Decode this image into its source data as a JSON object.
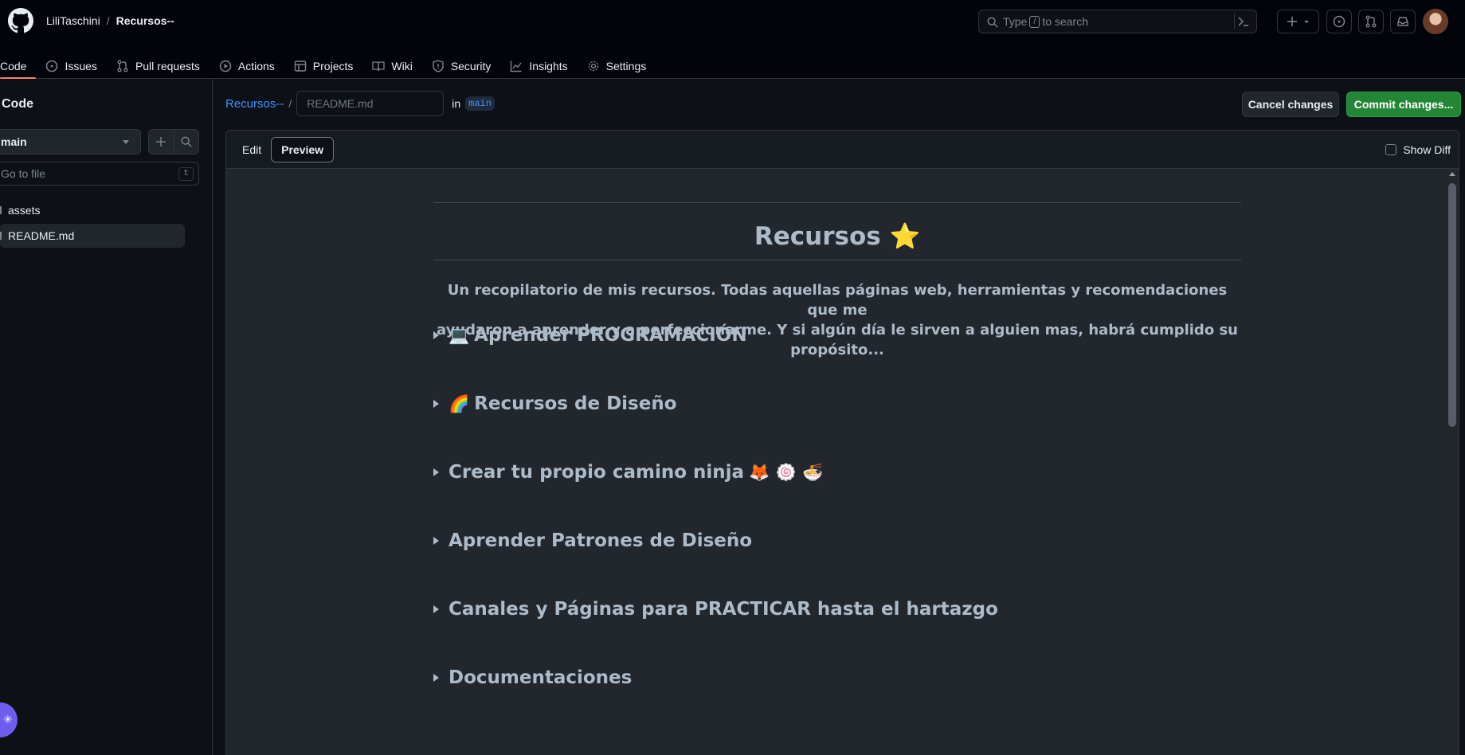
{
  "header": {
    "owner": "LiliTaschini",
    "separator": "/",
    "repo": "Recursos--",
    "search_prefix": "Type",
    "search_key": "/",
    "search_suffix": "to search"
  },
  "tabs": [
    {
      "label": "Code",
      "icon": "code-icon",
      "active": true
    },
    {
      "label": "Issues",
      "icon": "issue-icon"
    },
    {
      "label": "Pull requests",
      "icon": "pull-request-icon"
    },
    {
      "label": "Actions",
      "icon": "play-icon"
    },
    {
      "label": "Projects",
      "icon": "table-icon"
    },
    {
      "label": "Wiki",
      "icon": "book-icon"
    },
    {
      "label": "Security",
      "icon": "shield-icon"
    },
    {
      "label": "Insights",
      "icon": "graph-icon"
    },
    {
      "label": "Settings",
      "icon": "gear-icon"
    }
  ],
  "sidebar": {
    "title": "Code",
    "branch": "main",
    "goto_placeholder": "Go to file",
    "goto_shortcut": "t",
    "items": [
      {
        "label": "assets",
        "type": "folder"
      },
      {
        "label": "README.md",
        "type": "file",
        "selected": true
      }
    ]
  },
  "editor": {
    "repo_link": "Recursos--",
    "slash": "/",
    "filename_placeholder": "README.md",
    "in_label": "in",
    "branch": "main",
    "cancel_label": "Cancel changes",
    "commit_label": "Commit changes...",
    "edit_tab": "Edit",
    "preview_tab": "Preview",
    "show_diff_label": "Show Diff"
  },
  "preview": {
    "title": "Recursos",
    "title_emoji": "⭐",
    "intro_line1": "Un recopilatorio de mis recursos. Todas aquellas páginas web, herramientas y recomendaciones que me",
    "intro_line2": "ayudaron a aprender y a perfeccionarme. Y si algún día le sirven a alguien mas, habrá cumplido su propósito...",
    "sections": [
      {
        "emoji": "💻",
        "label": "Aprender PROGRAMACIÓN",
        "trailing": ""
      },
      {
        "emoji": "🌈",
        "label": "Recursos de Diseño",
        "trailing": ""
      },
      {
        "emoji": "",
        "label": "Crear tu propio camino ninja",
        "trailing": "🦊 🍥 🍜"
      },
      {
        "emoji": "",
        "label": "Aprender Patrones de Diseño",
        "trailing": ""
      },
      {
        "emoji": "",
        "label": "Canales y Páginas para PRACTICAR hasta el hartazgo",
        "trailing": ""
      },
      {
        "emoji": "",
        "label": "Documentaciones",
        "trailing": ""
      }
    ]
  },
  "colors": {
    "accent_link": "#4493f8",
    "commit_green": "#238636",
    "active_tab_underline": "#f78166"
  }
}
